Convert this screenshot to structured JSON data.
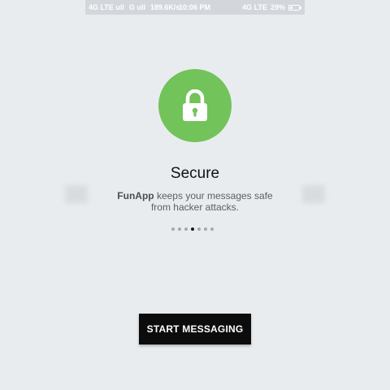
{
  "status_bar": {
    "network_left": "4G LTE ull",
    "network_mid": "G ull",
    "speed": "189.6K/s",
    "time": "10:06 PM",
    "network_right": "4G LTE",
    "battery": "29%"
  },
  "onboarding": {
    "title": "Secure",
    "app_name": "FunApp",
    "description_line1_rest": " keeps your messages safe",
    "description_line2": "from hacker attacks.",
    "page_count": 7,
    "active_page": 3
  },
  "actions": {
    "start_label": "START MESSAGING"
  },
  "colors": {
    "accent": "#72c35a",
    "background": "#e9ecef",
    "button": "#0c0c0c"
  },
  "icons": {
    "hero": "lock-icon"
  }
}
